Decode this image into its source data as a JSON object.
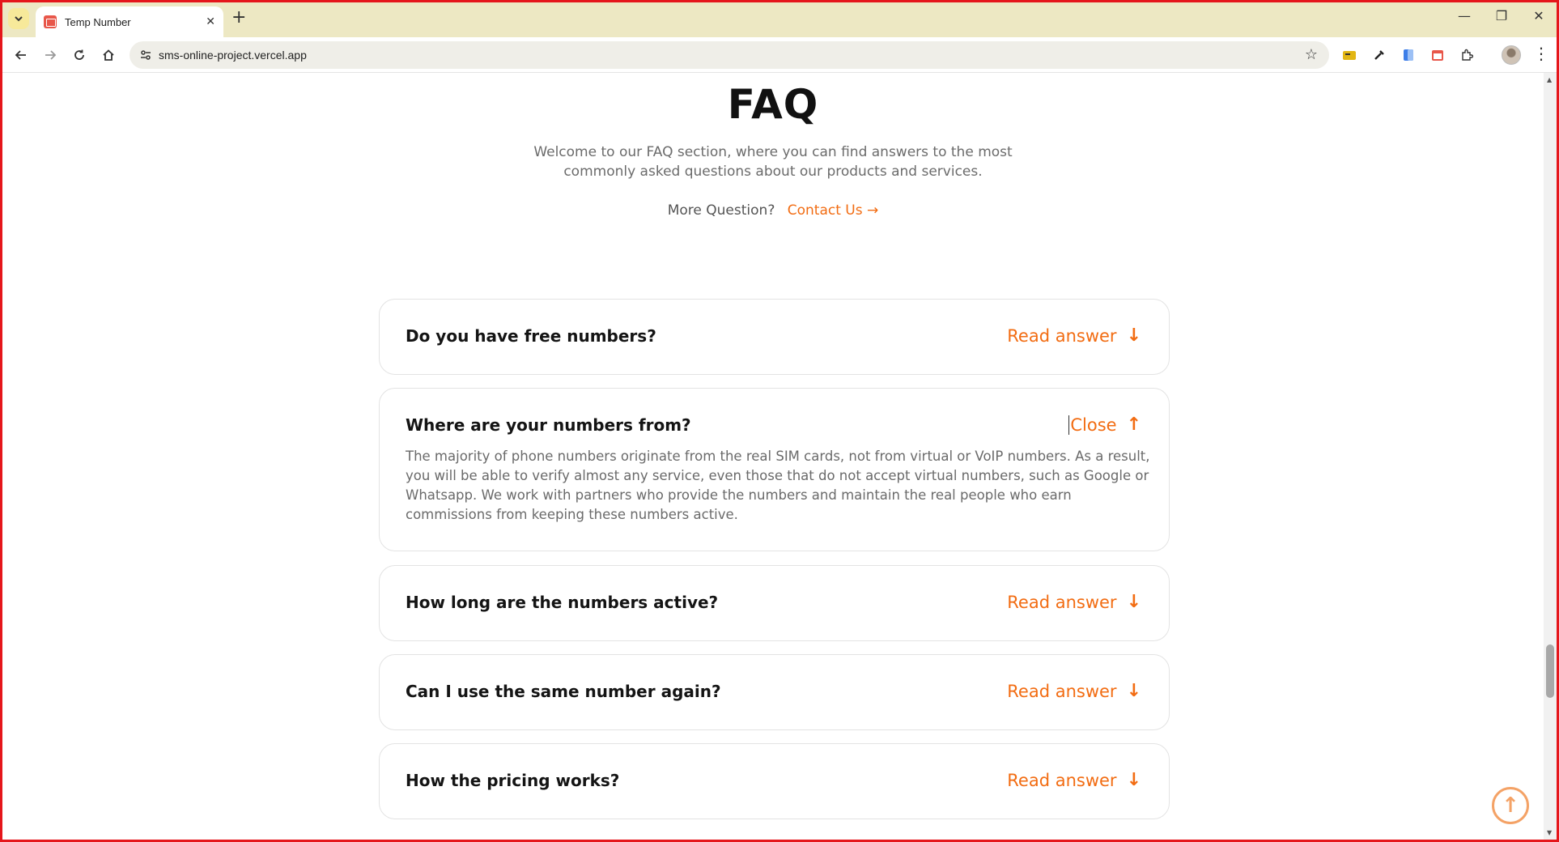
{
  "browser": {
    "tab_title": "Temp Number",
    "tab_close": "✕",
    "new_tab": "+",
    "url": "sms-online-project.vercel.app",
    "window_controls": {
      "minimize": "—",
      "restore": "❐",
      "close": "✕"
    }
  },
  "faq": {
    "title": "FAQ",
    "intro": "Welcome to our FAQ section, where you can find answers to the most commonly asked questions about our products and services.",
    "more_question": "More Question?",
    "contact_label": "Contact Us",
    "contact_arrow": "→",
    "items": [
      {
        "question": "Do you have free numbers?",
        "action": "Read answer",
        "arrow": "↓"
      },
      {
        "question": "Where are your numbers from?",
        "action": "Close",
        "arrow": "↑",
        "answer": "The majority of phone numbers originate from the real SIM cards, not from virtual or VoIP numbers. As a result, you will be able to verify almost any service, even those that do not accept virtual numbers, such as Google or Whatsapp. We work with partners who provide the numbers and maintain the real people who earn commissions from keeping these numbers active."
      },
      {
        "question": "How long are the numbers active?",
        "action": "Read answer",
        "arrow": "↓"
      },
      {
        "question": "Can I use the same number again?",
        "action": "Read answer",
        "arrow": "↓"
      },
      {
        "question": "How the pricing works?",
        "action": "Read answer",
        "arrow": "↓"
      }
    ]
  },
  "scroll_top_arrow": "↑",
  "colors": {
    "accent": "#f26c12",
    "frame": "#e5161b",
    "tabstrip": "#ede8c3"
  }
}
